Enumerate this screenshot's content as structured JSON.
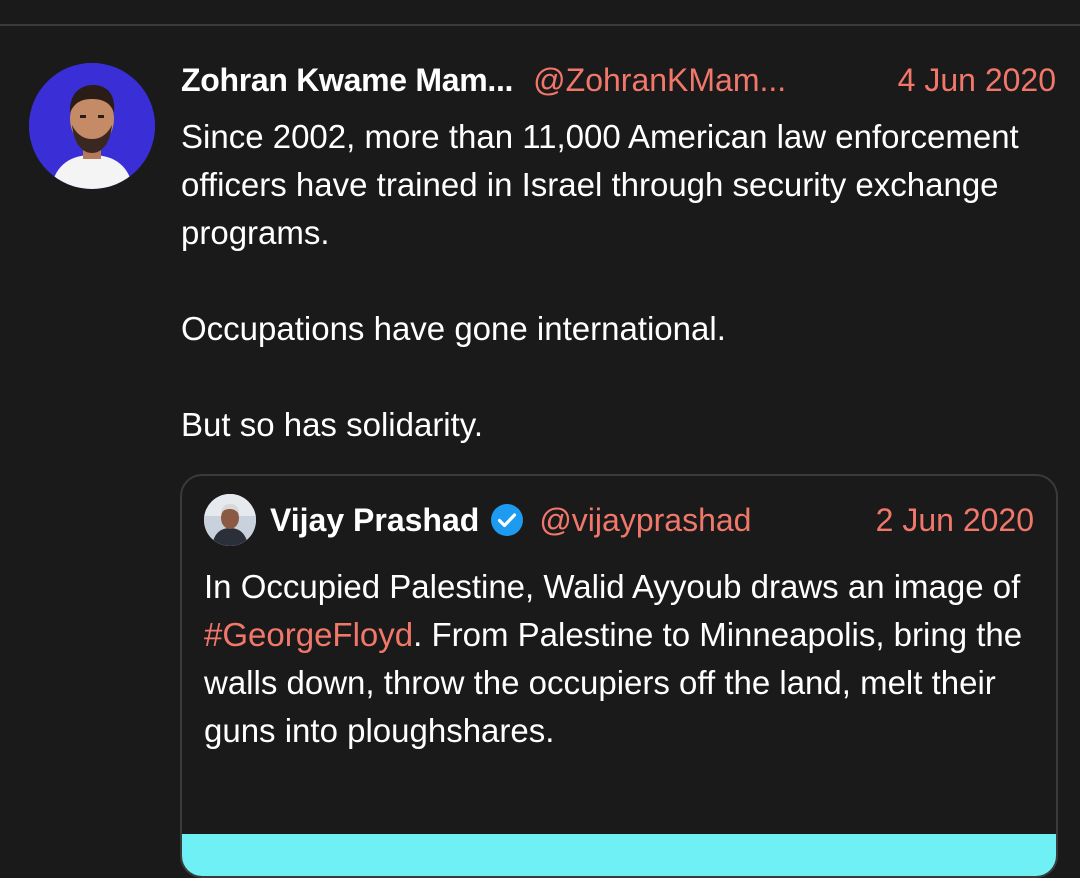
{
  "tweet": {
    "author_name": "Zohran Kwame Mam...",
    "author_handle": "@ZohranKMam...",
    "date": "4 Jun 2020",
    "paragraphs": [
      "Since 2002, more than 11,000 American law enforcement officers have trained in Israel through security exchange programs.",
      "Occupations have gone international.",
      "But so has solidarity."
    ]
  },
  "quoted_tweet": {
    "author_name": "Vijay Prashad",
    "verified": true,
    "author_handle": "@vijayprashad",
    "date": "2 Jun 2020",
    "text_before_hashtag": "In Occupied Palestine, Walid Ayyoub draws an image of ",
    "hashtag": "#GeorgeFloyd",
    "text_after_hashtag": ". From Palestine to Minneapolis, bring the walls down, throw the occupiers off the land, melt their guns into ploughshares."
  },
  "colors": {
    "background": "#1a1a1a",
    "accent": "#f2776b",
    "divider": "#3a3a3a",
    "verified": "#1d9bf0",
    "media_preview": "#6ff0f5",
    "avatar_bg": "#3a2fd6"
  }
}
